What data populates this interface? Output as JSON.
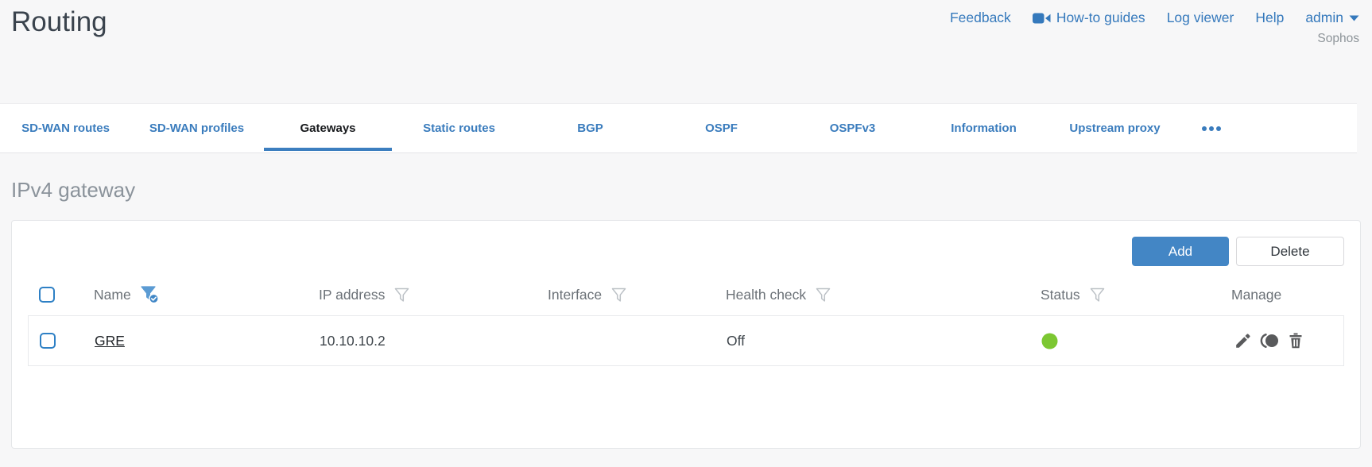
{
  "header": {
    "title": "Routing",
    "links": [
      {
        "label": "Feedback"
      },
      {
        "label": "How-to guides",
        "icon": "video-camera-icon"
      },
      {
        "label": "Log viewer"
      },
      {
        "label": "Help"
      },
      {
        "label": "admin",
        "icon": "caret-down-icon"
      }
    ],
    "brand": "Sophos"
  },
  "tabs": [
    {
      "label": "SD-WAN routes",
      "active": false
    },
    {
      "label": "SD-WAN profiles",
      "active": false
    },
    {
      "label": "Gateways",
      "active": true
    },
    {
      "label": "Static routes",
      "active": false
    },
    {
      "label": "BGP",
      "active": false
    },
    {
      "label": "OSPF",
      "active": false
    },
    {
      "label": "OSPFv3",
      "active": false
    },
    {
      "label": "Information",
      "active": false
    },
    {
      "label": "Upstream proxy",
      "active": false
    }
  ],
  "section": {
    "title": "IPv4 gateway"
  },
  "toolbar": {
    "add_label": "Add",
    "delete_label": "Delete"
  },
  "table": {
    "columns": [
      {
        "label": "Name",
        "filter": "active"
      },
      {
        "label": "IP address",
        "filter": "inactive"
      },
      {
        "label": "Interface",
        "filter": "inactive"
      },
      {
        "label": "Health check",
        "filter": "inactive"
      },
      {
        "label": "Status",
        "filter": "inactive"
      },
      {
        "label": "Manage",
        "filter": "none"
      }
    ],
    "rows": [
      {
        "name": "GRE",
        "ip_address": "10.10.10.2",
        "interface": "",
        "health_check": "Off",
        "status_color": "#7cc732",
        "manage": [
          "edit",
          "clone",
          "delete"
        ]
      }
    ]
  },
  "colors": {
    "link_blue": "#3a7cbd",
    "accent_blue": "#4386c5",
    "status_green": "#7cc732"
  }
}
